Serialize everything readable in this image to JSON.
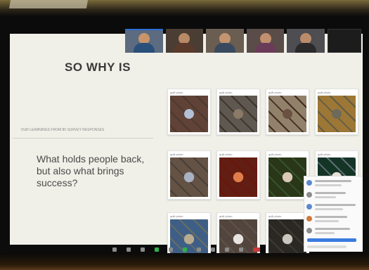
{
  "slide": {
    "title": "SO WHY IS",
    "caption": "OUR LEARNINGS FROM 80 SURVEY RESPONSES",
    "headline": "What holds people back, but also what brings success?"
  },
  "gallery": [
    {
      "caption": "quilt photo",
      "colors": [
        "#6b4a3a",
        "#e4e7ef",
        "#b3c0d6"
      ]
    },
    {
      "caption": "quilt photo",
      "colors": [
        "#6f6a66",
        "#d7d3ca",
        "#8a7a66"
      ]
    },
    {
      "caption": "quilt photo",
      "colors": [
        "#9b8c78",
        "#f0ebe2",
        "#6a5142"
      ]
    },
    {
      "caption": "quilt photo",
      "colors": [
        "#e3dcc8",
        "#b08a45",
        "#6d6a5a"
      ]
    },
    {
      "caption": "quilt photo",
      "colors": [
        "#6d5a4a",
        "#e9ecef",
        "#a8b2c2"
      ]
    },
    {
      "caption": "quilt photo",
      "colors": [
        "#7a2a1e",
        "#cfb9a3",
        "#e07d4a"
      ]
    },
    {
      "caption": "quilt photo",
      "colors": [
        "#3f6a3a",
        "#a6826a",
        "#d9c8b6"
      ]
    },
    {
      "caption": "quilt photo",
      "colors": [
        "#6a7e8a",
        "#2f6a47",
        "#e6e0d6"
      ]
    },
    {
      "caption": "quilt photo",
      "colors": [
        "#8fa4b0",
        "#6f93c2",
        "#b8ab8f"
      ]
    },
    {
      "caption": "quilt photo",
      "colors": [
        "#6a5c52",
        "#c4c0c0",
        "#e8e3df"
      ]
    },
    {
      "caption": "quilt photo",
      "colors": [
        "#4c4a44",
        "#8b8a84",
        "#c9c6bd"
      ]
    }
  ],
  "participants": [
    {
      "name": "",
      "skin": "#c8956a",
      "shirt": "#2a4f7a",
      "bg": "#5c6b80"
    },
    {
      "name": "",
      "skin": "#b98a66",
      "shirt": "#5a3a2a",
      "bg": "#4a3e34"
    },
    {
      "name": "",
      "skin": "#c49470",
      "shirt": "#3a4a5e",
      "bg": "#6a5e52"
    },
    {
      "name": "",
      "skin": "#c2906e",
      "shirt": "#6b3b5a",
      "bg": "#5a4c48"
    },
    {
      "name": "",
      "skin": "#bb8c6a",
      "shirt": "#2a2a2a",
      "bg": "#4d4d52"
    }
  ],
  "chat": {
    "messages": [
      {
        "color": "#5a8ad0"
      },
      {
        "color": "#8c8c8c"
      },
      {
        "color": "#5a8ad0"
      },
      {
        "color": "#d07a3a"
      },
      {
        "color": "#8c8c8c"
      }
    ]
  },
  "colors": {
    "slide_bg": "#f1f0e8",
    "title": "#3a3a3a",
    "accent": "#2a6ed8",
    "join_green": "#2fb24c",
    "leave_red": "#c93b3b"
  },
  "toolbar": {
    "buttons": [
      {
        "icon": "mic-icon",
        "kind": "normal"
      },
      {
        "icon": "camera-icon",
        "kind": "normal"
      },
      {
        "icon": "security-icon",
        "kind": "normal"
      },
      {
        "icon": "participants-icon",
        "kind": "green"
      },
      {
        "icon": "chat-icon",
        "kind": "normal"
      },
      {
        "icon": "share-screen-icon",
        "kind": "green"
      },
      {
        "icon": "record-icon",
        "kind": "normal"
      },
      {
        "icon": "reactions-icon",
        "kind": "normal"
      },
      {
        "icon": "apps-icon",
        "kind": "normal"
      },
      {
        "icon": "more-icon",
        "kind": "normal"
      },
      {
        "icon": "leave-icon",
        "kind": "red"
      }
    ]
  }
}
